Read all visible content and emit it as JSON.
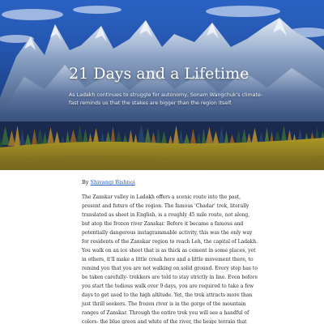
{
  "hero": {
    "title": "21 Days and a Lifetime",
    "subtitle": "As Ladakh continues to struggle for autonomy, Sonam Wangchuk's climate-fast reminds us that the stakes are bigger than the region itself.",
    "image": "snowy-mountains-forest-illustration"
  },
  "byline": {
    "prefix": "By",
    "author": "Shivangi Bishnoi"
  },
  "article": {
    "body": "The Zanskar valley in Ladakh offers a scenic route into the past, present and future of the region. The famous 'Chadar' trek, literally translated as sheet in English, is a roughly 45 mile route, not along, but atop the frozen river Zanskar. Before it became a famous and potentially dangerous instagrammable activity, this was the only way for residents of the Zanskar region to reach Leh, the capital of Ladakh. You walk on an ice sheet that is as thick as cement in some places, yet in others, it'll make a little creak here and a little movement there, to remind you that you are not walking on solid ground. Every step has to be taken carefully- trekkers are told to stay strictly in line. Even before you start the tedious walk over 9 days, you are required to take a few days to get used to the high altitude. Yet, the trek attracts more than just thrill seekers. The frozen river is in the gorge of the mountain ranges of Zanskar. Through the entire trek you will see a handful of colors- the blue green and white of the river, the beige terrain that immediately"
  },
  "colors": {
    "link": "#1f56c2",
    "sky_top": "#2558b5",
    "sky_bottom": "#1c3c78",
    "field": "#d2b21a"
  }
}
